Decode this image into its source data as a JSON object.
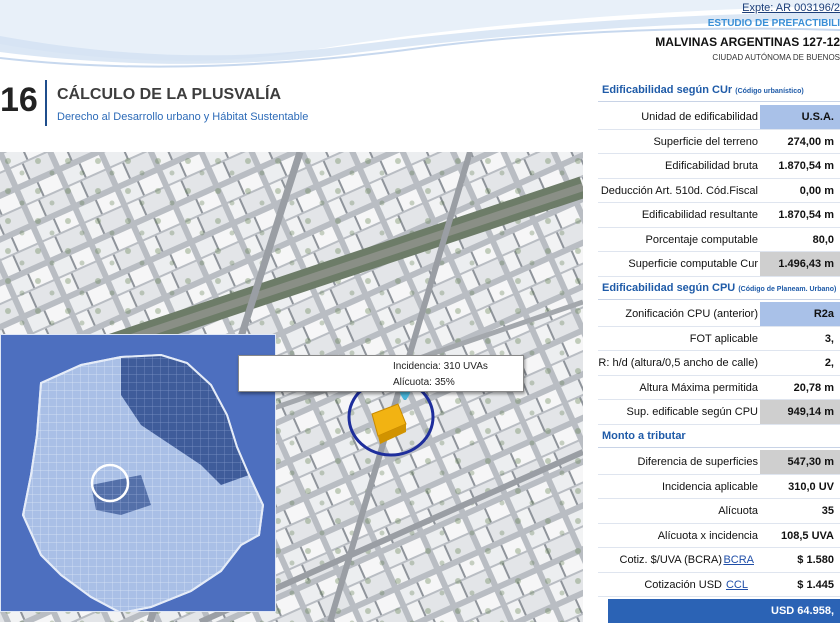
{
  "header": {
    "expediente": "Expte: AR 003196/2",
    "estudio": "ESTUDIO DE PREFACTIBILI",
    "direccion": "MALVINAS ARGENTINAS 127-12",
    "ciudad": "CIUDAD AUTÓNOMA DE BUENOS"
  },
  "section": {
    "number": "16",
    "title": "CÁLCULO DE LA PLUSVALÍA",
    "subtitle": "Derecho al Desarrollo urbano y Hábitat Sustentable"
  },
  "map": {
    "callout_line1": "Incidencia: 310 UVAs",
    "callout_line2": "Alícuota: 35%"
  },
  "cur": {
    "title": "Edificabilidad según CUr",
    "note": "(Código urbanístico)",
    "rows": [
      {
        "label": "Unidad de edificabilidad",
        "value": "U.S.A."
      },
      {
        "label": "Superficie del terreno",
        "value": "274,00 m"
      },
      {
        "label": "Edificabilidad bruta",
        "value": "1.870,54 m"
      },
      {
        "label": "Deducción Art. 510d. Cód.Fiscal",
        "value": "0,00 m"
      },
      {
        "label": "Edificabilidad resultante",
        "value": "1.870,54 m"
      },
      {
        "label": "Porcentaje computable",
        "value": "80,0"
      },
      {
        "label": "Superficie computable Cur",
        "value": "1.496,43 m"
      }
    ]
  },
  "cpu": {
    "title": "Edificabilidad según CPU",
    "note": "(Código de Planeam. Urbano)",
    "rows": [
      {
        "label": "Zonificación CPU (anterior)",
        "value": "R2a"
      },
      {
        "label": "FOT aplicable",
        "value": "3,"
      },
      {
        "label": "R: h/d (altura/0,5 ancho de calle)",
        "value": "2,"
      },
      {
        "label": "Altura Máxima permitida",
        "value": "20,78 m"
      },
      {
        "label": "Sup. edificable según CPU",
        "value": "949,14 m"
      }
    ]
  },
  "monto": {
    "title": "Monto a tributar",
    "rows": [
      {
        "label": "Diferencia de superficies",
        "value": "547,30 m"
      },
      {
        "label": "Incidencia aplicable",
        "value": "310,0 UV"
      },
      {
        "label": "Alícuota",
        "value": "35"
      },
      {
        "label": "Alícuota x incidencia",
        "value": "108,5 UVA"
      },
      {
        "label": "Cotiz. $/UVA (BCRA)",
        "link": "BCRA",
        "value": "$ 1.580"
      },
      {
        "label": "Cotización USD",
        "link": "CCL",
        "value": "$ 1.445"
      }
    ],
    "total": "USD 64.958,"
  }
}
